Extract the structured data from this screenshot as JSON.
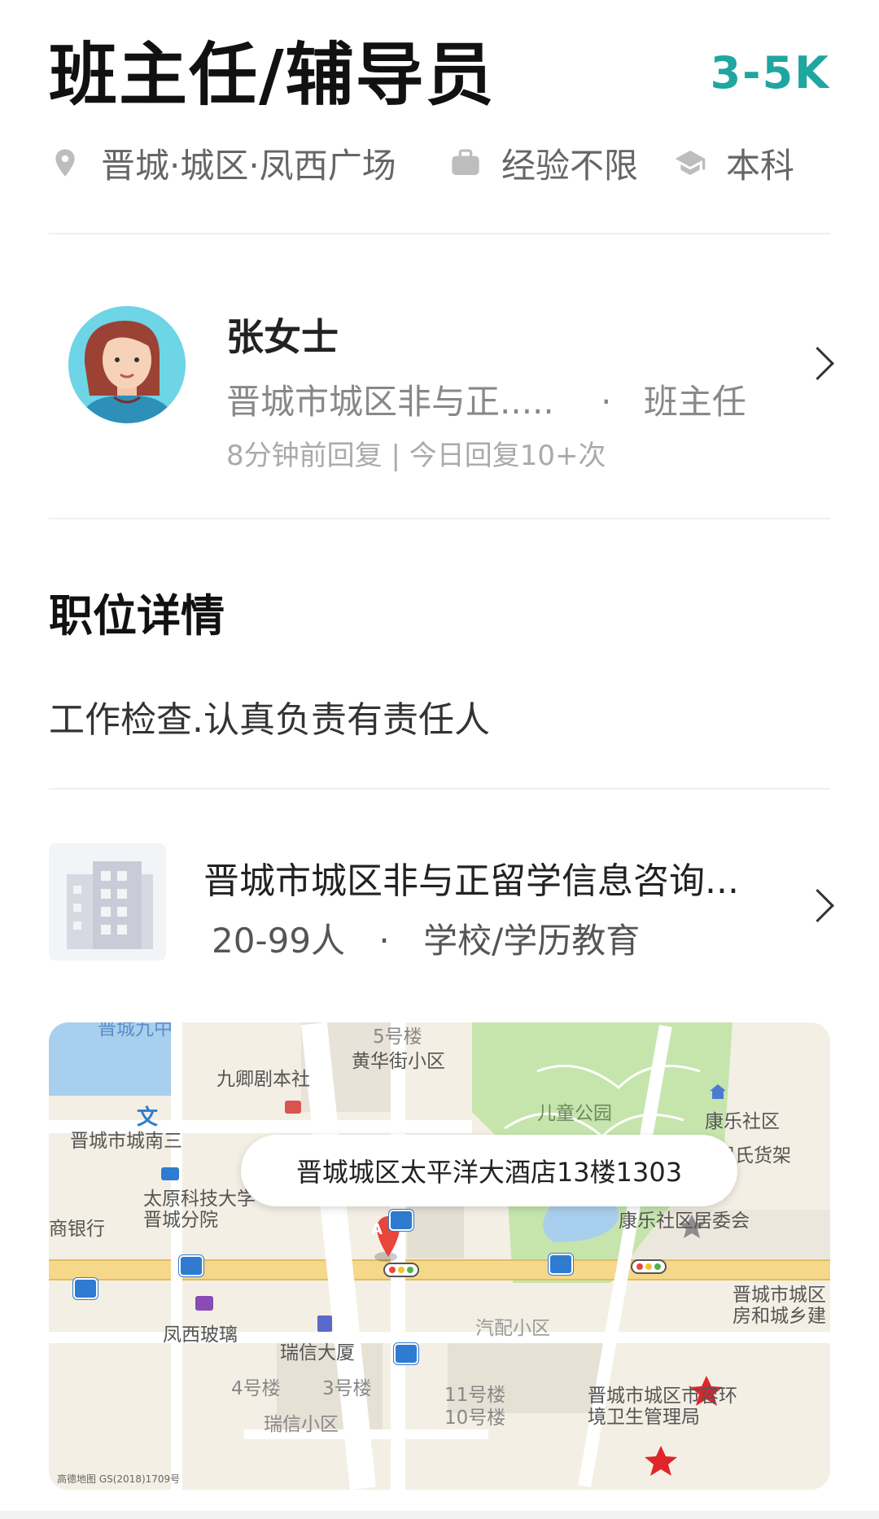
{
  "job": {
    "title": "班主任/辅导员",
    "salary": "3-5K",
    "location": "晋城·城区·凤西广场",
    "experience": "经验不限",
    "education": "本科"
  },
  "recruiter": {
    "name": "张女士",
    "company_short": "晋城市城区非与正.....",
    "separator": "·",
    "role": "班主任",
    "reply_info": "8分钟前回复 | 今日回复10+次"
  },
  "details": {
    "section_title": "职位详情",
    "description": "工作检查.认真负责有责任人"
  },
  "company": {
    "name": "晋城市城区非与正留学信息咨询...",
    "size": "20-99人",
    "separator": "·",
    "industry": "学校/学历教育"
  },
  "map": {
    "address": "晋城城区太平洋大酒店13楼1303",
    "marker": "A",
    "attribution": "高德地图 GS(2018)1709号",
    "labels": {
      "top_left": "晋城九中",
      "building5": "5号楼",
      "huanghua": "黄华街小区",
      "jiuqing": "九卿剧本社",
      "wen": "文",
      "jincheng_south": "晋城市城南三",
      "taiyuan_uni": "太原科技大学晋城分院",
      "bank": "商银行",
      "park": "儿童公园",
      "kangle": "康乐社区",
      "zhoushi": "周氏货架",
      "kangle_committee": "康乐社区居委会",
      "housing_bureau": "晋城市城区房和城乡建",
      "fengxi_glass": "凤西玻璃",
      "ruixin_tower": "瑞信大厦",
      "qipei": "汽配小区",
      "b4": "4号楼",
      "b3": "3号楼",
      "b11": "11号楼",
      "b10": "10号楼",
      "ruixin_community": "瑞信小区",
      "city_admin": "晋城市城区市容环境卫生管理局"
    }
  },
  "colors": {
    "salary": "#1fa6a1",
    "map_bg": "#f4efe4",
    "park": "#c6e5ad",
    "water": "#a9cfee",
    "road_main": "#f6d88a"
  }
}
